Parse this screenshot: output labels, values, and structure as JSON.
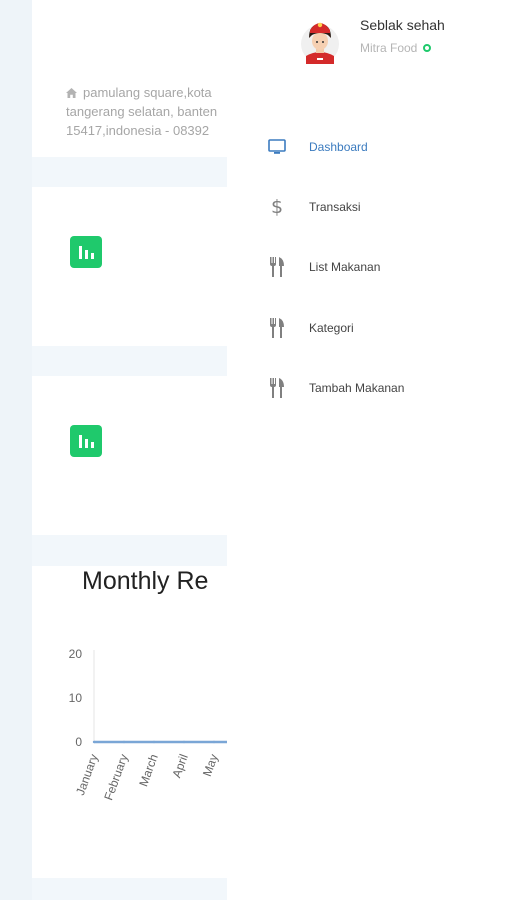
{
  "background": {
    "address": "pamulang square,kota tangerang selatan, banten 15417,indonesia - 08392",
    "chart": {
      "title": "Monthly Revenue",
      "icon_color": "#1fc96c"
    }
  },
  "chart_data": {
    "type": "line",
    "title": "Monthly Re",
    "categories": [
      "January",
      "February",
      "March",
      "April",
      "May"
    ],
    "series": [
      {
        "values": [
          0,
          0,
          0,
          0,
          0
        ]
      }
    ],
    "ylim": [
      0,
      20
    ],
    "yticks": [
      "20",
      "10",
      "0"
    ],
    "line_color": "#7aa6d6",
    "grid": false
  },
  "drawer": {
    "user": {
      "name": "Seblak sehah",
      "subtitle": "Mitra Food",
      "status": "online"
    },
    "menu": [
      {
        "label": "Dashboard",
        "icon": "monitor-icon",
        "active": true
      },
      {
        "label": "Transaksi",
        "icon": "dollar-icon"
      },
      {
        "label": "List Makanan",
        "icon": "cutlery-icon"
      },
      {
        "label": "Kategori",
        "icon": "cutlery-icon"
      },
      {
        "label": "Tambah Makanan",
        "icon": "cutlery-icon"
      }
    ],
    "colors": {
      "active": "#3b7bbf",
      "status": "#1fc96c"
    }
  }
}
